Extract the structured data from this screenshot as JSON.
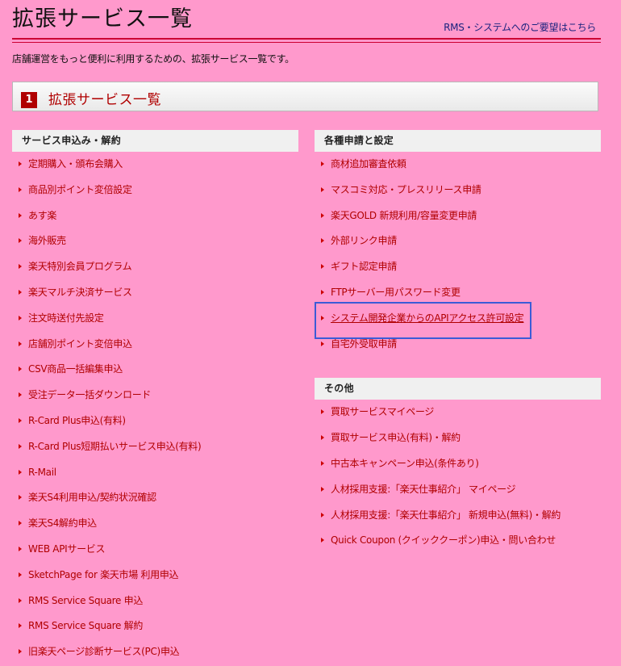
{
  "header": {
    "title": "拡張サービス一覧",
    "feedback_link": "RMS・システムへのご要望はこちら"
  },
  "intro": "店舗運営をもっと便利に利用するための、拡張サービス一覧です。",
  "section": {
    "number": "1",
    "title": "拡張サービス一覧"
  },
  "left_column": {
    "header": "サービス申込み・解約",
    "items": [
      "定期購入・頒布会購入",
      "商品別ポイント変倍設定",
      "あす楽",
      "海外販売",
      "楽天特別会員プログラム",
      "楽天マルチ決済サービス",
      "注文時送付先設定",
      "店舗別ポイント変倍申込",
      "CSV商品一括編集申込",
      "受注データ一括ダウンロード",
      "R-Card Plus申込(有料)",
      "R-Card Plus短期払いサービス申込(有料)",
      "R-Mail",
      "楽天S4利用申込/契約状況確認",
      "楽天S4解約申込",
      "WEB APIサービス",
      "SketchPage for 楽天市場 利用申込",
      "RMS Service Square 申込",
      "RMS Service Square 解約",
      "旧楽天ページ診断サービス(PC)申込"
    ]
  },
  "right_column": {
    "sections": [
      {
        "header": "各種申請と設定",
        "items": [
          "商材追加審査依頼",
          "マスコミ対応・プレスリリース申請",
          "楽天GOLD 新規利用/容量変更申請",
          "外部リンク申請",
          "ギフト認定申請",
          "FTPサーバー用パスワード変更",
          "システム開発企業からのAPIアクセス許可設定",
          "自宅外受取申請"
        ]
      },
      {
        "header": "その他",
        "items": [
          "買取サービスマイページ",
          "買取サービス申込(有料)・解約",
          "中古本キャンペーン申込(条件あり)",
          "人材採用支援:「楽天仕事紹介」 マイページ",
          "人材採用支援:「楽天仕事紹介」 新規申込(無料)・解約",
          "Quick Coupon (クイッククーポン)申込・問い合わせ"
        ]
      }
    ]
  },
  "colors": {
    "background": "#ff99cc",
    "link": "#b00000",
    "rule": "#cc0033",
    "highlight_box": "#3b5bd6"
  }
}
